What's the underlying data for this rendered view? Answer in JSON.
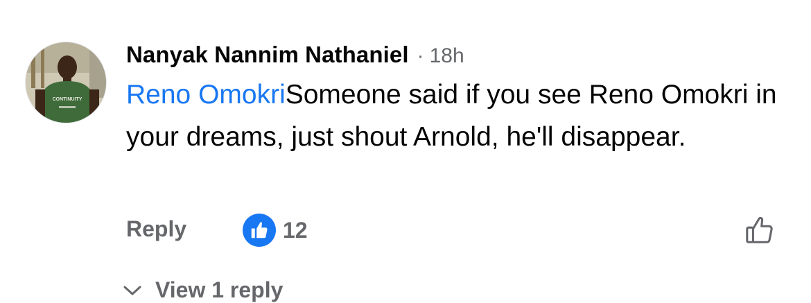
{
  "comment": {
    "author": "Nanyak Nannim Nathaniel",
    "separator": "·",
    "time": "18h",
    "mention": "Reno Omokri",
    "text": "Someone said if you see Reno Omokri in your dreams, just shout Arnold, he'll disappear.",
    "avatar_shirt_text": "CONTINUITY"
  },
  "actions": {
    "reply_label": "Reply",
    "reaction_icon": "like-reaction-icon",
    "reaction_count": "12",
    "like_icon": "thumbs-up-outline-icon"
  },
  "replies": {
    "view_label": "View 1 reply",
    "icon": "chevron-down-icon"
  },
  "colors": {
    "link": "#1877f2",
    "secondary_text": "#65676b",
    "primary_text": "#050505"
  }
}
